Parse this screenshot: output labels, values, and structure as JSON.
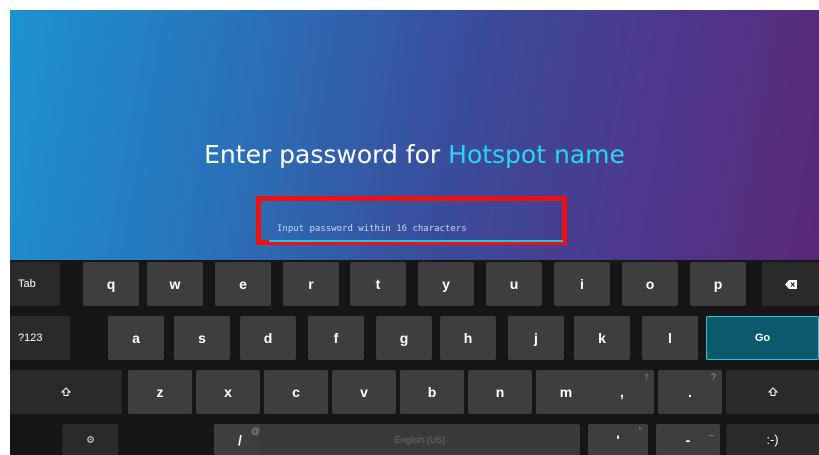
{
  "prompt": {
    "prefix": "Enter password for ",
    "ssid": "Hotspot name"
  },
  "password": {
    "placeholder": "Input password within 16 characters",
    "value": ""
  },
  "keyboard": {
    "row1": {
      "tab": "Tab",
      "keys": [
        "q",
        "w",
        "e",
        "r",
        "t",
        "y",
        "u",
        "i",
        "o",
        "p"
      ],
      "backspace_icon": "backspace-icon"
    },
    "row2": {
      "symbols": "?123",
      "keys": [
        "a",
        "s",
        "d",
        "f",
        "g",
        "h",
        "j",
        "k",
        "l"
      ],
      "go": "Go"
    },
    "row3": {
      "shift_icon": "shift-icon",
      "keys": [
        "z",
        "x",
        "c",
        "v",
        "b",
        "n",
        "m"
      ],
      "comma": ",",
      "comma_hint": "!",
      "period": ".",
      "period_hint": "?"
    },
    "row4": {
      "settings_icon": "settings-icon",
      "slash": "/",
      "slash_hint": "@",
      "space_label": "English (US)",
      "apostrophe": "'",
      "apostrophe_hint": "\"",
      "dash": "-",
      "dash_hint": "_",
      "smiley": ":-)"
    }
  },
  "colors": {
    "accent": "#27d6f2",
    "highlight_box": "#ee1111",
    "go_key": "#0a5a6b"
  }
}
